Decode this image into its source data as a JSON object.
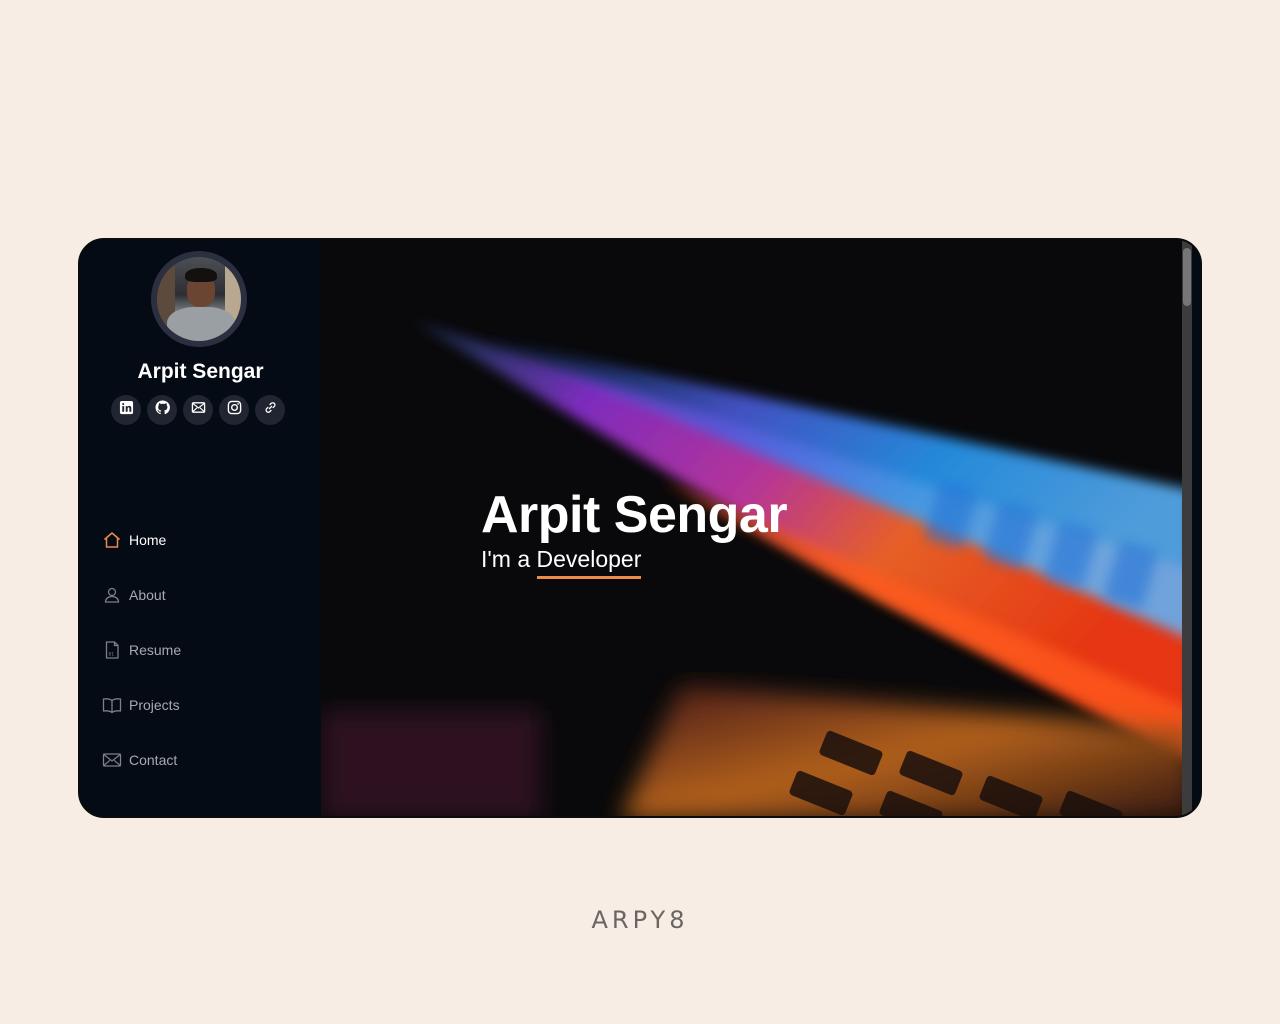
{
  "profile": {
    "name": "Arpit Sengar"
  },
  "socials": [
    {
      "icon": "linkedin-icon"
    },
    {
      "icon": "github-icon"
    },
    {
      "icon": "mail-icon"
    },
    {
      "icon": "instagram-icon"
    },
    {
      "icon": "link-icon"
    }
  ],
  "nav": {
    "items": [
      {
        "label": "Home",
        "icon": "home-icon",
        "active": true
      },
      {
        "label": "About",
        "icon": "user-icon",
        "active": false
      },
      {
        "label": "Resume",
        "icon": "file-icon",
        "active": false
      },
      {
        "label": "Projects",
        "icon": "book-icon",
        "active": false
      },
      {
        "label": "Contact",
        "icon": "envelope-icon",
        "active": false
      }
    ]
  },
  "hero": {
    "title": "Arpit Sengar",
    "prefix": "I'm a",
    "typed": "Developer"
  },
  "brand": "ARPY8",
  "colors": {
    "accent": "#f08a4b",
    "sidebar": "#040b14",
    "page_bg": "#f7ede4"
  }
}
